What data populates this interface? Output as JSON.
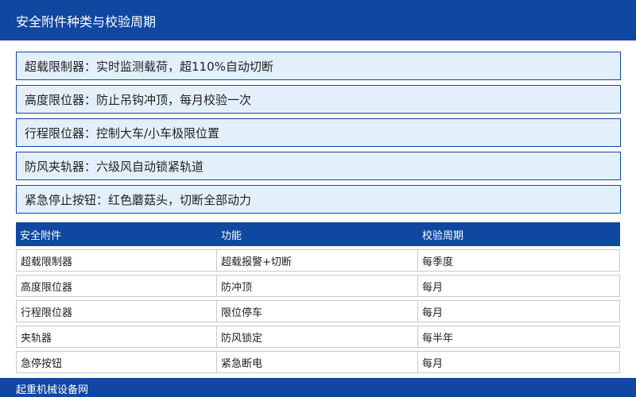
{
  "header": {
    "title": "安全附件种类与校验周期"
  },
  "items": [
    "超载限制器：实时监测载荷，超110%自动切断",
    "高度限位器：防止吊钩冲顶，每月校验一次",
    "行程限位器：控制大车/小车极限位置",
    "防风夹轨器：六级风自动锁紧轨道",
    "紧急停止按钮：红色蘑菇头，切断全部动力"
  ],
  "table": {
    "headers": [
      "安全附件",
      "功能",
      "校验周期"
    ],
    "rows": [
      [
        "超载限制器",
        "超载报警+切断",
        "每季度"
      ],
      [
        "高度限位器",
        "防冲顶",
        "每月"
      ],
      [
        "行程限位器",
        "限位停车",
        "每月"
      ],
      [
        "夹轨器",
        "防风锁定",
        "每半年"
      ],
      [
        "急停按钮",
        "紧急断电",
        "每月"
      ]
    ]
  },
  "footer": {
    "text": "起重机械设备网"
  }
}
